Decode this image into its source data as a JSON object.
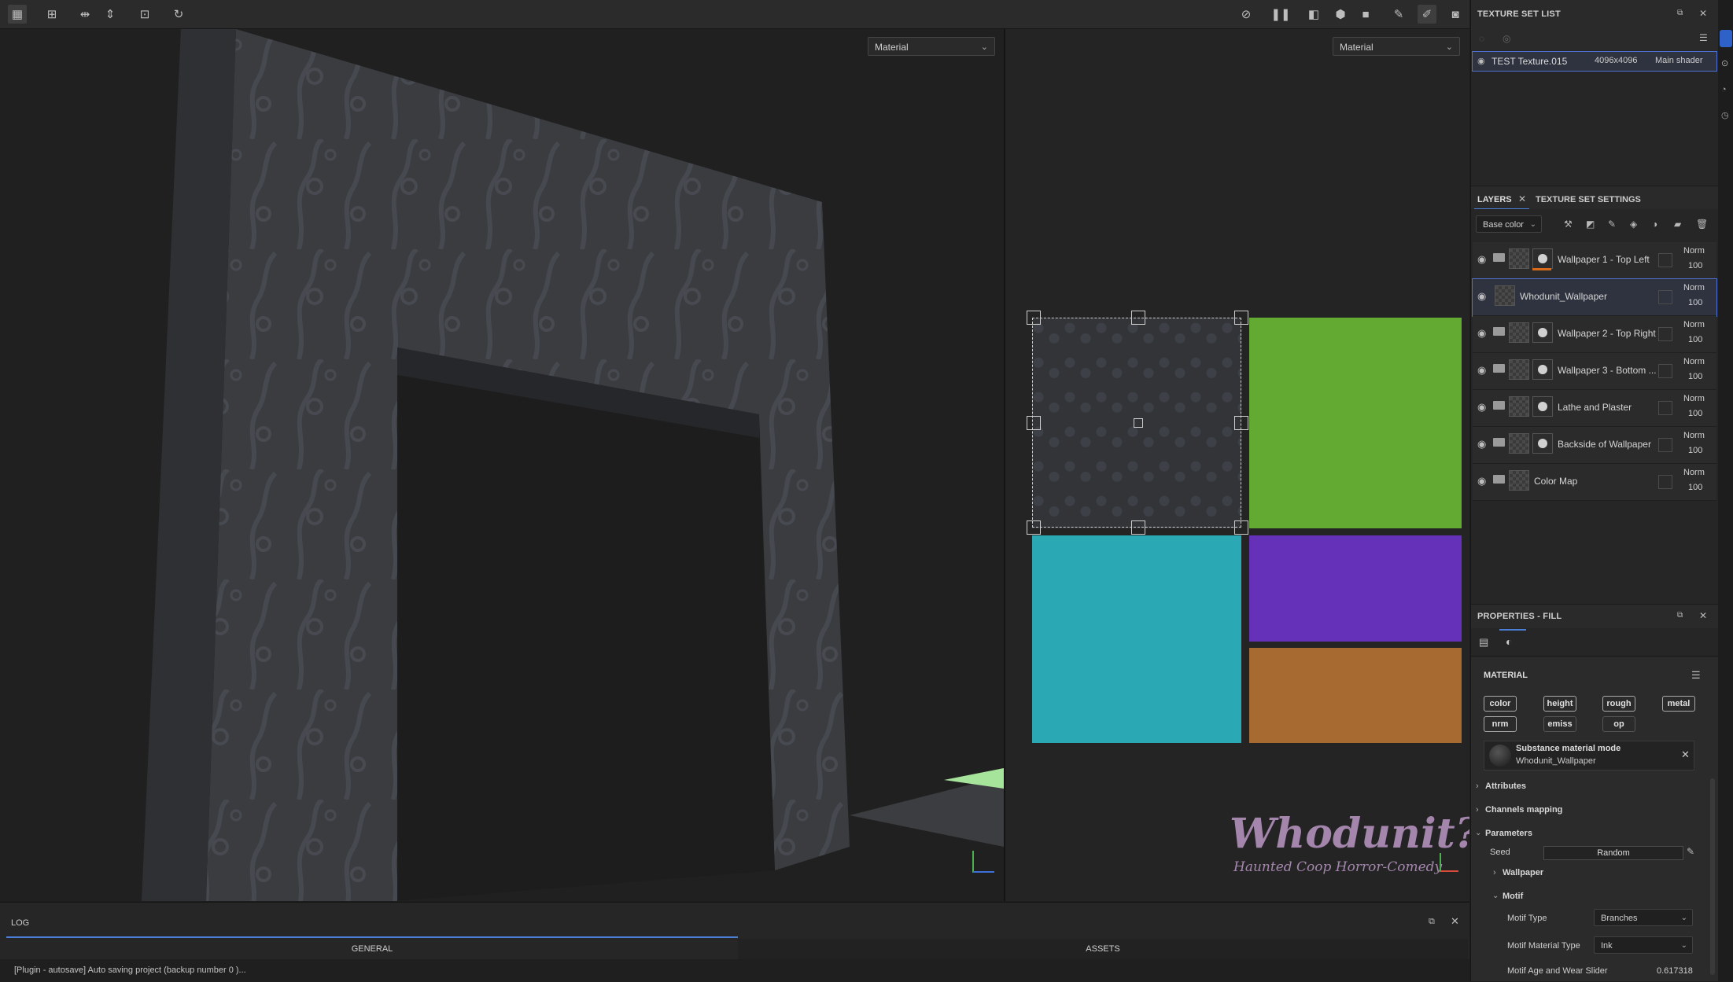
{
  "toolbar": {
    "left_icons": [
      "select-grid-icon",
      "tiling-icon",
      "mirror-x-icon",
      "mirror-y-icon",
      "add-frame-icon",
      "history-icon"
    ],
    "right_icons": [
      "hide-icon",
      "pause-icon",
      "split-view-icon",
      "cube-icon",
      "camera-icon",
      "brush-alt-icon",
      "paint-brush-icon",
      "screenshot-icon"
    ]
  },
  "viewport3d": {
    "dropdown": "Material"
  },
  "viewport2d": {
    "dropdown": "Material",
    "uv_colors": {
      "top_right": "#63aa33",
      "bottom_left": "#2aa9b5",
      "mid_right": "#6531b8",
      "bottom_right": "#a76a31"
    },
    "watermark_title": "Whodunit?",
    "watermark_subtitle": "Haunted Coop Horror-Comedy"
  },
  "texture_set_list": {
    "title": "TEXTURE SET LIST",
    "item": {
      "name": "TEST Texture.015",
      "size": "4096x4096",
      "shader": "Main shader"
    }
  },
  "layers_panel": {
    "tabs": [
      "LAYERS",
      "TEXTURE SET SETTINGS"
    ],
    "channel": "Base color",
    "items": [
      {
        "name": "Wallpaper 1 - Top Left",
        "blend": "Norm",
        "opacity": "100",
        "folder": true,
        "mask": true,
        "accent": "#d86a1c"
      },
      {
        "name": "Whodunit_Wallpaper",
        "blend": "Norm",
        "opacity": "100",
        "folder": false,
        "mask": false,
        "selected": true
      },
      {
        "name": "Wallpaper 2 - Top Right",
        "blend": "Norm",
        "opacity": "100",
        "folder": true,
        "mask": true
      },
      {
        "name": "Wallpaper 3 - Bottom ...",
        "blend": "Norm",
        "opacity": "100",
        "folder": true,
        "mask": true
      },
      {
        "name": "Lathe and Plaster",
        "blend": "Norm",
        "opacity": "100",
        "folder": true,
        "mask": true
      },
      {
        "name": "Backside of Wallpaper",
        "blend": "Norm",
        "opacity": "100",
        "folder": true,
        "mask": true
      },
      {
        "name": "Color Map",
        "blend": "Norm",
        "opacity": "100",
        "folder": true,
        "mask": false
      }
    ]
  },
  "properties": {
    "title": "PROPERTIES - FILL",
    "material_label": "MATERIAL",
    "channels": [
      "color",
      "height",
      "rough",
      "metal",
      "nrm",
      "emiss",
      "op"
    ],
    "substance_mode": "Substance material mode",
    "substance_name": "Whodunit_Wallpaper",
    "attributes": "Attributes",
    "channels_mapping": "Channels mapping",
    "parameters": "Parameters",
    "seed_label": "Seed",
    "seed_button": "Random",
    "wallpaper_group": "Wallpaper",
    "motif_group": "Motif",
    "motif_type_label": "Motif Type",
    "motif_type_value": "Branches",
    "motif_material_label": "Motif Material Type",
    "motif_material_value": "Ink",
    "motif_age_label": "Motif Age and Wear Slider",
    "motif_age_value": "0.617318"
  },
  "log": {
    "title": "LOG",
    "tabs": [
      "GENERAL",
      "ASSETS"
    ],
    "message": "[Plugin - autosave] Auto saving project (backup number 0 )..."
  }
}
